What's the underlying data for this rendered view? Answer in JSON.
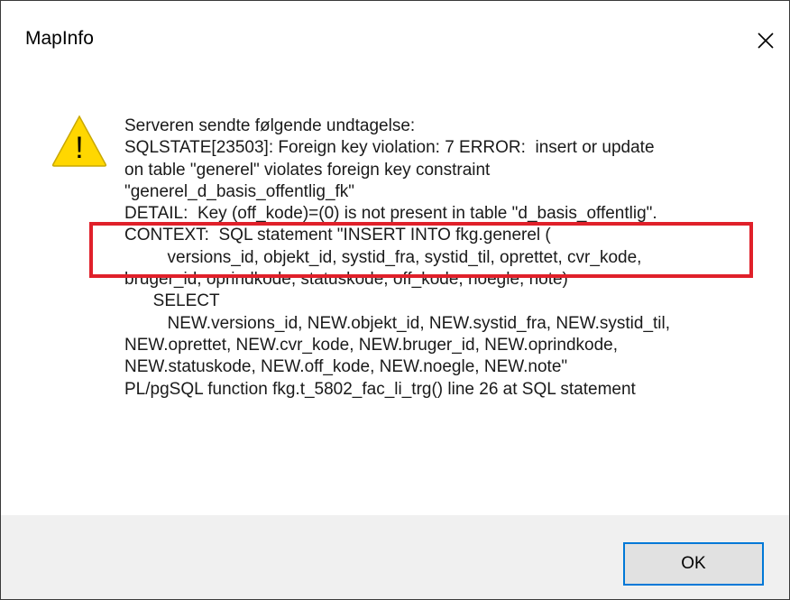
{
  "window": {
    "title": "MapInfo"
  },
  "icons": {
    "warning": "warning-triangle-icon",
    "warning_symbol": "!",
    "close": "close-x-icon"
  },
  "message": {
    "lines": [
      "Serveren sendte følgende undtagelse:",
      "SQLSTATE[23503]: Foreign key violation: 7 ERROR:  insert or update",
      "on table \"generel\" violates foreign key constraint",
      "\"generel_d_basis_offentlig_fk\"",
      "DETAIL:  Key (off_kode)=(0) is not present in table \"d_basis_offentlig\".",
      "CONTEXT:  SQL statement \"INSERT INTO fkg.generel (",
      "         versions_id, objekt_id, systid_fra, systid_til, oprettet, cvr_kode,",
      "bruger_id, oprindkode, statuskode, off_kode, noegle, note)",
      "      SELECT",
      "         NEW.versions_id, NEW.objekt_id, NEW.systid_fra, NEW.systid_til,",
      "NEW.oprettet, NEW.cvr_kode, NEW.bruger_id, NEW.oprindkode,",
      "NEW.statuskode, NEW.off_kode, NEW.noegle, NEW.note\"",
      "PL/pgSQL function fkg.t_5802_fac_li_trg() line 26 at SQL statement"
    ]
  },
  "buttons": {
    "ok_label": "OK"
  },
  "colors": {
    "highlight": "#e0202a",
    "warning_fill": "#ffd700",
    "button_border": "#0078d7",
    "footer_bg": "#f0f0f0"
  }
}
